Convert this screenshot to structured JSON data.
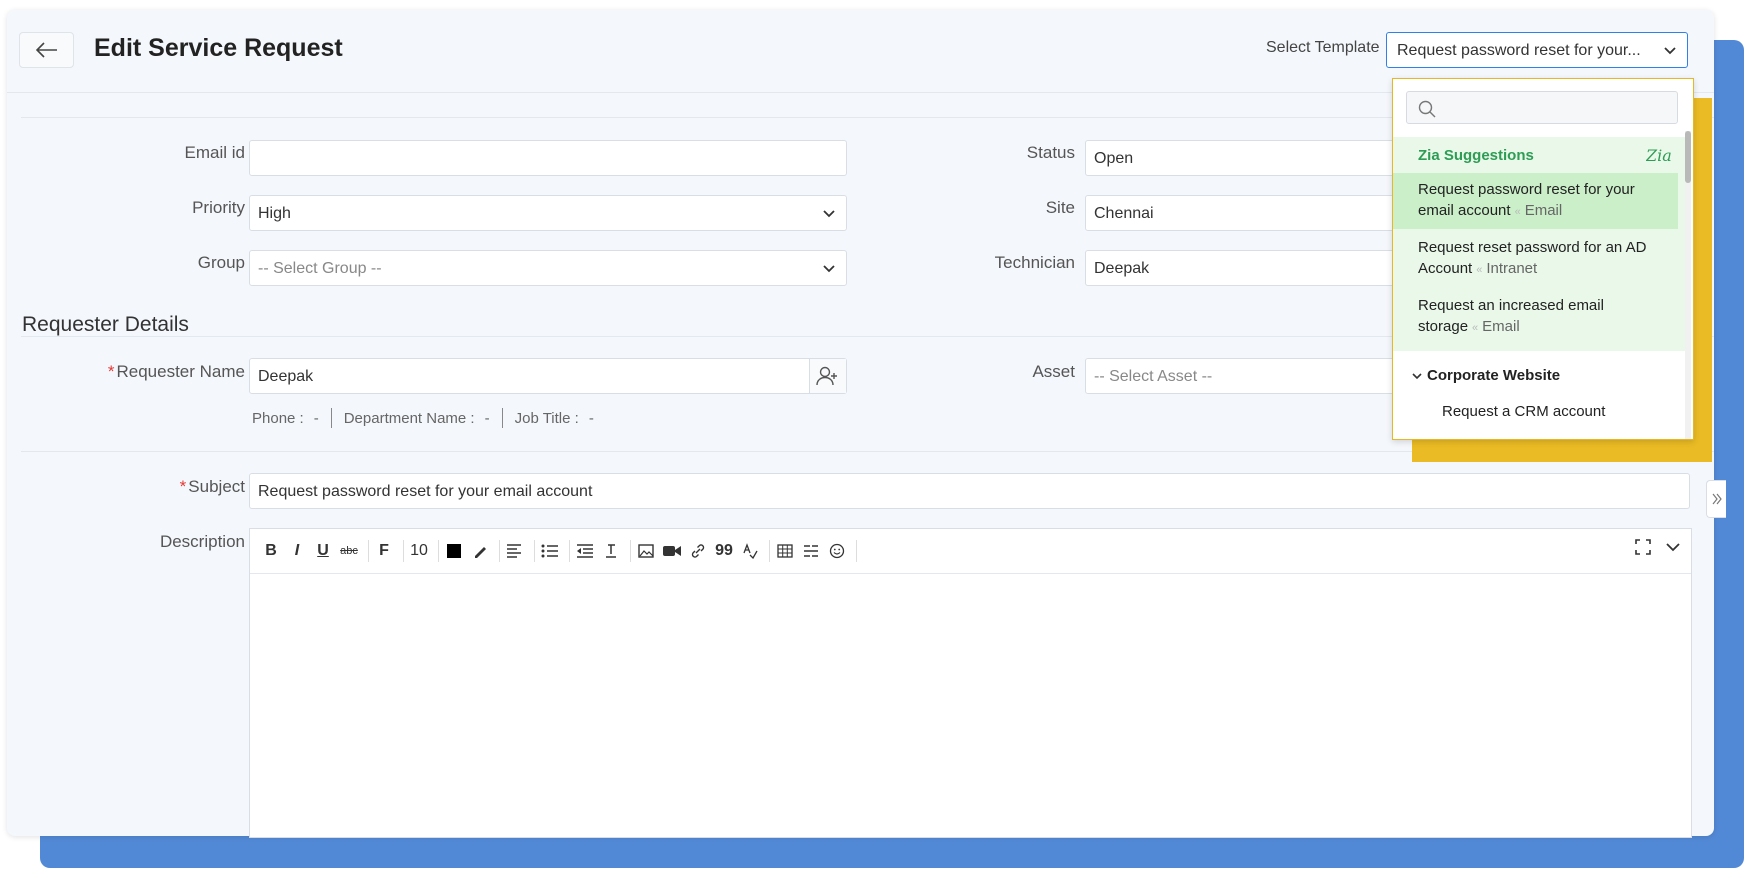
{
  "header": {
    "title": "Edit Service Request",
    "template_label": "Select Template",
    "template_value": "Request password reset for your..."
  },
  "form": {
    "email_label": "Email id",
    "email_value": "",
    "priority_label": "Priority",
    "priority_value": "High",
    "group_label": "Group",
    "group_value": "-- Select Group --",
    "status_label": "Status",
    "status_value": "Open",
    "site_label": "Site",
    "site_value": "Chennai",
    "technician_label": "Technician",
    "technician_value": "Deepak",
    "requester_section": "Requester Details",
    "requester_label": "Requester Name",
    "requester_value": "Deepak",
    "asset_label": "Asset",
    "asset_value": "-- Select Asset --",
    "phone_label": "Phone :",
    "phone_value": "-",
    "department_label": "Department Name :",
    "department_value": "-",
    "job_title_label": "Job Title :",
    "job_title_value": "-",
    "subject_label": "Subject",
    "subject_value": "Request password reset for your email account",
    "description_label": "Description",
    "required_mark": "*"
  },
  "editor": {
    "bold": "B",
    "italic": "I",
    "underline": "U",
    "strike": "abc",
    "font": "F",
    "font_size": "10",
    "quote": "99"
  },
  "dropdown": {
    "search_placeholder": "",
    "zia_header": "Zia Suggestions",
    "zia_logo": "Zia",
    "suggestions": [
      {
        "line1": "Request password reset for your",
        "line2": "email account",
        "category": "Email"
      },
      {
        "line1": "Request reset password for an AD",
        "line2": "Account",
        "category": "Intranet"
      },
      {
        "line1": "Request an increased email",
        "line2": "storage",
        "category": "Email"
      }
    ],
    "group_header": "Corporate Website",
    "group_items": [
      "Request a CRM account"
    ]
  },
  "colors": {
    "accent_blue": "#2f80ed",
    "zia_green": "#2d9d55",
    "selected_green": "#cbefc9",
    "highlight_yellow": "#eabb24",
    "background_blue": "#5289d6"
  }
}
